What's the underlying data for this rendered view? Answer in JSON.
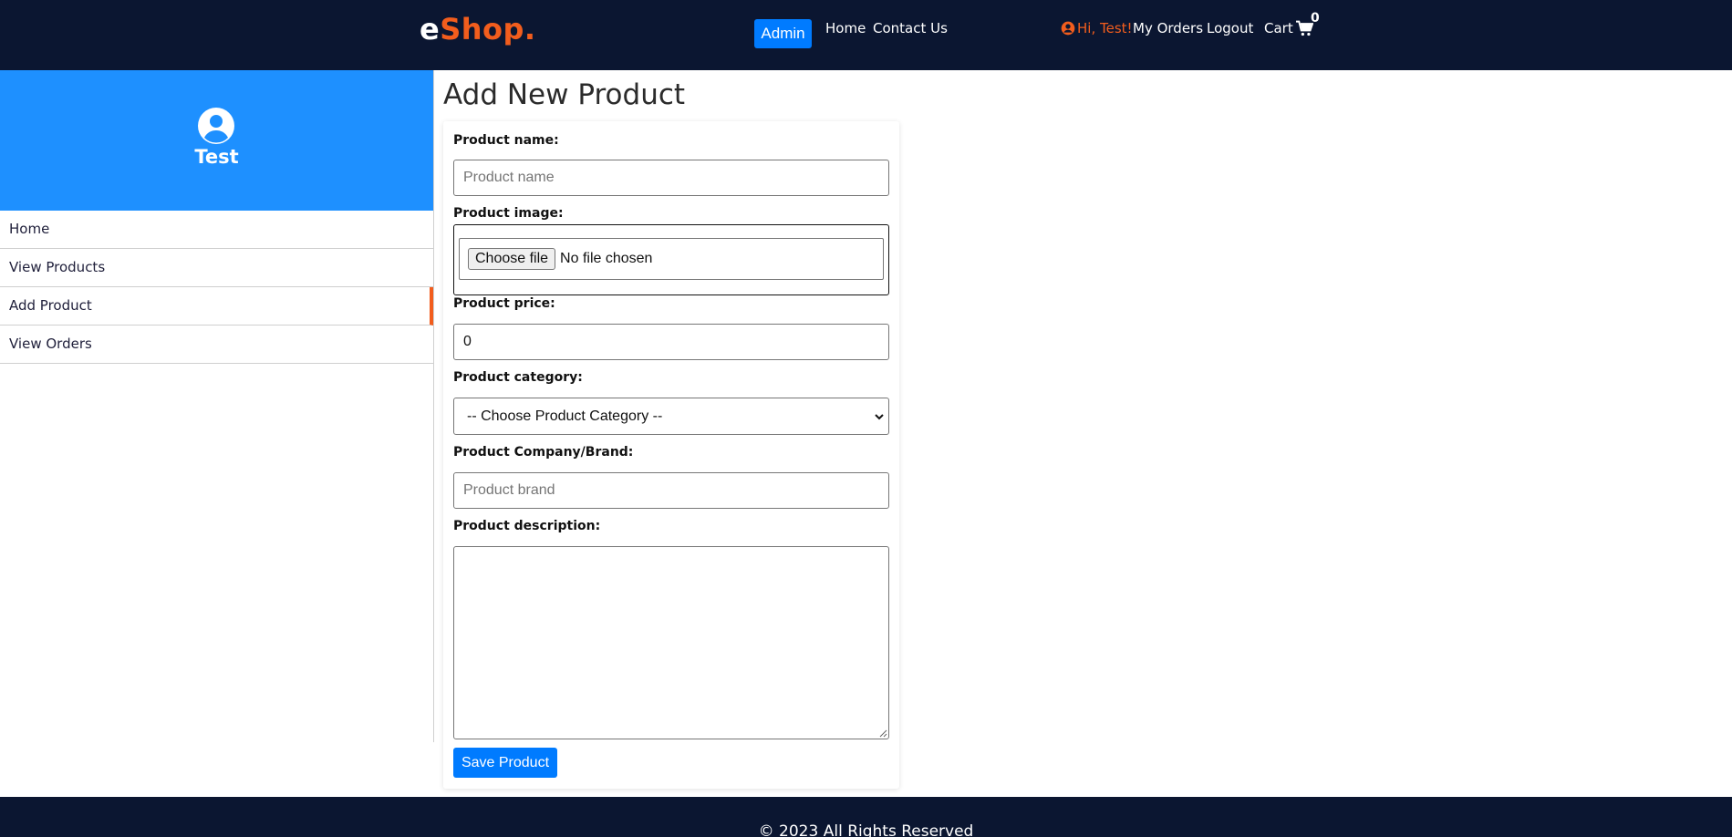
{
  "header": {
    "logo_main": "e",
    "logo_accent": "Shop.",
    "admin_label": "Admin",
    "nav": [
      "Home",
      "Contact Us"
    ],
    "greeting": "Hi, Test!",
    "my_orders": "My Orders",
    "logout": "Logout",
    "cart_label": "Cart",
    "cart_count": "0"
  },
  "sidebar": {
    "username": "Test",
    "items": [
      "Home",
      "View Products",
      "Add Product",
      "View Orders"
    ],
    "active": "Add Product"
  },
  "main": {
    "title": "Add New Product",
    "form": {
      "name_label": "Product name:",
      "name_placeholder": "Product name",
      "image_label": "Product image:",
      "choose_file": "Choose file",
      "no_file": "No file chosen",
      "price_label": "Product price:",
      "price_value": "0",
      "category_label": "Product category:",
      "category_selected": "-- Choose Product Category --",
      "brand_label": "Product Company/Brand:",
      "brand_placeholder": "Product brand",
      "description_label": "Product description:",
      "description_value": "",
      "save_label": "Save Product"
    }
  },
  "footer": {
    "text": "© 2023 All Rights Reserved"
  },
  "colors": {
    "nav_bg": "#0b1631",
    "accent": "#f25d1d",
    "primary": "#007bff",
    "profile_bg": "#1e90ff"
  },
  "icons": {
    "user": "user-circle-icon",
    "cart": "shopping-cart-icon",
    "dropdown": "chevron-down-icon"
  }
}
